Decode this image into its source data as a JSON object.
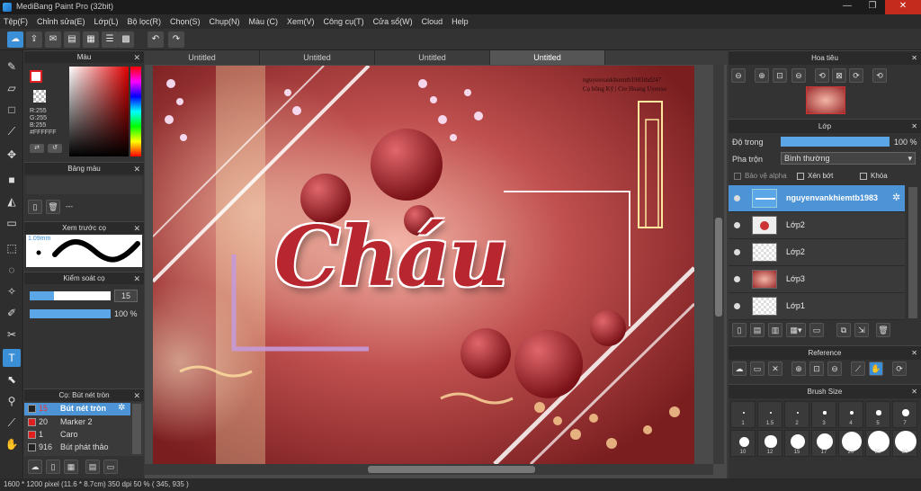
{
  "window": {
    "title": "MediBang Paint Pro (32bit)",
    "minimize": "—",
    "maximize": "❐",
    "close": "✕"
  },
  "menu": [
    "Tệp(F)",
    "Chỉnh sửa(E)",
    "Lớp(L)",
    "Bộ lọc(R)",
    "Chọn(S)",
    "Chụp(N)",
    "Màu (C)",
    "Xem(V)",
    "Công cụ(T)",
    "Cửa sổ(W)",
    "Cloud",
    "Help"
  ],
  "tabs": [
    "Untitled",
    "Untitled",
    "Untitled",
    "Untitled"
  ],
  "active_tab": 3,
  "color_panel": {
    "title": "Màu",
    "r": "R:255",
    "g": "G:255",
    "b": "B:255",
    "hex": "#FFFFFF"
  },
  "palette_panel": {
    "title": "Bảng màu",
    "empty": "---"
  },
  "brush_preview": {
    "title": "Xem trước cọ",
    "size": "1.09mm"
  },
  "brush_control": {
    "title": "Kiểm soát cọ",
    "size_value": "15",
    "opacity_value": "100 %",
    "size_fraction": 0.3,
    "opacity_fraction": 1.0
  },
  "brush_list": {
    "title": "Cọ: Bút nét tròn",
    "items": [
      {
        "size": "15",
        "name": "Bút nét tròn",
        "color": "#222222",
        "selected": true
      },
      {
        "size": "20",
        "name": "Marker 2",
        "color": "#e02020",
        "selected": false
      },
      {
        "size": "1",
        "name": "Caro",
        "color": "#e02020",
        "selected": false
      },
      {
        "size": "916",
        "name": "Bút phát thảo",
        "color": "#222222",
        "selected": false
      }
    ]
  },
  "artwork": {
    "main_text": "Cháu",
    "credit_line1": "nguyenvankhiemtb1983thd247",
    "credit_line2": "Cọ bông   Kỹ | Cre Hoang   Uyenxe"
  },
  "navigator": {
    "title": "Hoa tiêu"
  },
  "layer_panel": {
    "title": "Lớp",
    "opacity_label": "Độ trong",
    "opacity_value": "100 %",
    "opacity_fraction": 1.0,
    "blend_label": "Pha trộn",
    "blend_value": "Bình thường",
    "protect_alpha": "Bảo vệ alpha",
    "clipping": "Xén bớt",
    "lock": "Khóa",
    "layers": [
      {
        "name": "nguyenvankhiemtb1983",
        "selected": true
      },
      {
        "name": "Lớp2",
        "selected": false
      },
      {
        "name": "Lớp2",
        "selected": false
      },
      {
        "name": "Lớp3",
        "selected": false
      },
      {
        "name": "Lớp1",
        "selected": false
      }
    ]
  },
  "reference": {
    "title": "Reference"
  },
  "brush_size": {
    "title": "Brush Size",
    "row1": [
      "1",
      "1.5",
      "2",
      "3",
      "4",
      "5",
      "7"
    ],
    "row2": [
      "10",
      "12",
      "15",
      "17",
      "20",
      "25",
      "30"
    ]
  },
  "status": {
    "text": "1600 * 1200 pixel  (11.6 * 8.7cm)  350 dpi  50 %  ( 345, 935 )"
  }
}
